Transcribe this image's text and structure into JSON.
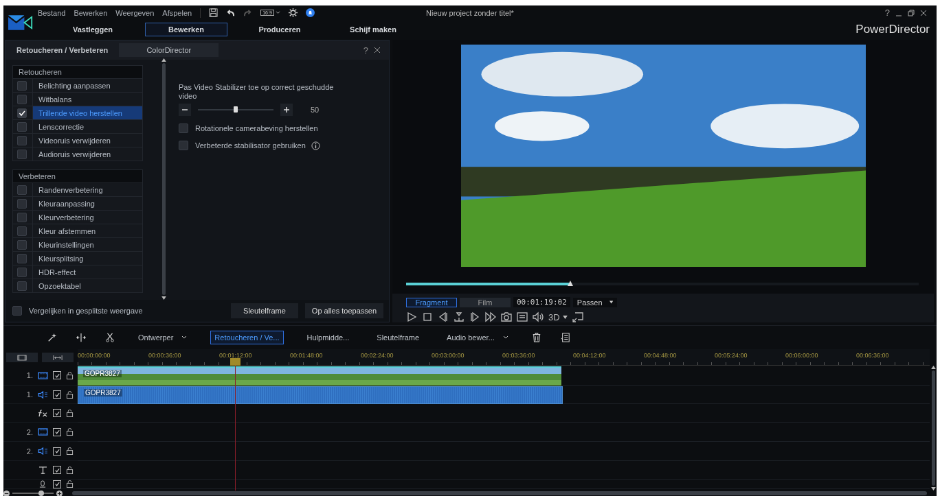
{
  "menu": [
    "Bestand",
    "Bewerken",
    "Weergeven",
    "Afspelen"
  ],
  "aspect_ratio": "16:9",
  "project_title": "Nieuw project zonder titel*",
  "help_label": "?",
  "app_name": "PowerDirector",
  "nav_tabs": [
    {
      "label": "Vastleggen",
      "selected": false
    },
    {
      "label": "Bewerken",
      "selected": true
    },
    {
      "label": "Produceren",
      "selected": false
    },
    {
      "label": "Schijf maken",
      "selected": false
    }
  ],
  "panel": {
    "tabs": [
      {
        "label": "Retoucheren / Verbeteren",
        "selected": true
      },
      {
        "label": "ColorDirector",
        "selected": false
      }
    ],
    "help_label": "?",
    "groups": [
      {
        "title": "Retoucheren",
        "items": [
          {
            "label": "Belichting aanpassen",
            "checked": false,
            "selected": false
          },
          {
            "label": "Witbalans",
            "checked": false,
            "selected": false
          },
          {
            "label": "Trillende video herstellen",
            "checked": true,
            "selected": true
          },
          {
            "label": "Lenscorrectie",
            "checked": false,
            "selected": false
          },
          {
            "label": "Videoruis verwijderen",
            "checked": false,
            "selected": false
          },
          {
            "label": "Audioruis verwijderen",
            "checked": false,
            "selected": false
          }
        ]
      },
      {
        "title": "Verbeteren",
        "items": [
          {
            "label": "Randenverbetering",
            "checked": false,
            "selected": false
          },
          {
            "label": "Kleuraanpassing",
            "checked": false,
            "selected": false
          },
          {
            "label": "Kleurverbetering",
            "checked": false,
            "selected": false
          },
          {
            "label": "Kleur afstemmen",
            "checked": false,
            "selected": false
          },
          {
            "label": "Kleurinstellingen",
            "checked": false,
            "selected": false
          },
          {
            "label": "Kleursplitsing",
            "checked": false,
            "selected": false
          },
          {
            "label": "HDR-effect",
            "checked": false,
            "selected": false
          },
          {
            "label": "Opzoektabel",
            "checked": false,
            "selected": false
          }
        ]
      }
    ],
    "settings": {
      "description": "Pas Video Stabilizer toe op correct geschudde video",
      "slider": {
        "level": 0.5,
        "value": "50"
      },
      "options": [
        {
          "label": "Rotationele camerabeving herstellen",
          "checked": false,
          "info": false
        },
        {
          "label": "Verbeterde stabilisator gebruiken",
          "checked": false,
          "info": true
        }
      ]
    },
    "compare": {
      "label": "Vergelijken in gesplitste weergave",
      "checked": false
    },
    "buttons": [
      "Sleutelframe",
      "Op alles toepassen"
    ]
  },
  "preview": {
    "scrubber": {
      "level": 0.32
    },
    "modes": [
      {
        "label": "Fragment",
        "selected": true
      },
      {
        "label": "Film",
        "selected": false
      }
    ],
    "timecode": "00:01:19:02",
    "fit": "Passen",
    "stereo_label": "3D"
  },
  "timeline_toolbar": [
    {
      "kind": "icon"
    },
    {
      "kind": "icon"
    },
    {
      "kind": "icon"
    },
    {
      "kind": "dropdown",
      "label": "Ontwerper",
      "selected": false
    },
    {
      "kind": "button",
      "label": "Retoucheren / Ve...",
      "selected": true
    },
    {
      "kind": "button",
      "label": "Hulpmidde...",
      "selected": false
    },
    {
      "kind": "button",
      "label": "Sleutelframe",
      "selected": false
    },
    {
      "kind": "dropdown",
      "label": "Audio bewer...",
      "selected": false
    },
    {
      "kind": "icon"
    },
    {
      "kind": "icon"
    }
  ],
  "ruler": {
    "labels": [
      "00:00:00:00",
      "00:00:36:00",
      "00:01:12:00",
      "00:01:48:00",
      "00:02:24:00",
      "00:03:00:00",
      "00:03:36:00",
      "00:04:12:00",
      "00:04:48:00",
      "00:05:24:00",
      "00:06:00:00",
      "00:06:36:00"
    ],
    "playhead": {
      "level": 0.185
    }
  },
  "tracks": [
    {
      "kind": "video",
      "number": "1.",
      "enabled": true,
      "clip": "GOPR3827"
    },
    {
      "kind": "audio",
      "number": "1.",
      "enabled": true,
      "clip": "GOPR3827"
    },
    {
      "kind": "fx",
      "enabled": true
    },
    {
      "kind": "video",
      "number": "2.",
      "enabled": true
    },
    {
      "kind": "audio",
      "number": "2.",
      "enabled": true
    },
    {
      "kind": "title",
      "enabled": true
    },
    {
      "kind": "voice",
      "enabled": true
    }
  ],
  "zoom": {
    "level": 0.7
  }
}
